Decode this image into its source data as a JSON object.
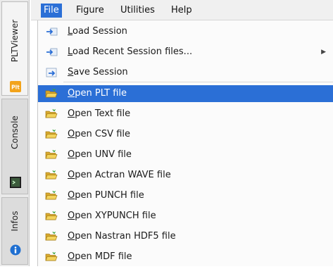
{
  "dock": {
    "tabs": [
      {
        "label": "PLTViewer",
        "icon": "plt-icon"
      },
      {
        "label": "Console",
        "icon": "console-icon"
      },
      {
        "label": "Infos",
        "icon": "info-icon"
      }
    ],
    "plt_icon_text": "Plt"
  },
  "menubar": {
    "items": [
      "File",
      "Figure",
      "Utilities",
      "Help"
    ]
  },
  "file_menu": {
    "items": [
      {
        "label": "Load Session",
        "icon": "load-session-icon"
      },
      {
        "label": "Load Recent Session files...",
        "icon": "load-session-icon",
        "submenu": true
      },
      {
        "label": "Save Session",
        "icon": "save-session-icon"
      },
      {
        "label": "Open PLT file",
        "icon": "folder-open-icon",
        "highlighted": true
      },
      {
        "label": "Open Text file",
        "icon": "folder-open-icon"
      },
      {
        "label": "Open CSV file",
        "icon": "folder-open-icon"
      },
      {
        "label": "Open UNV file",
        "icon": "folder-open-icon"
      },
      {
        "label": "Open Actran WAVE file",
        "icon": "folder-open-icon"
      },
      {
        "label": "Open PUNCH file",
        "icon": "folder-open-icon"
      },
      {
        "label": "Open XYPUNCH file",
        "icon": "folder-open-icon"
      },
      {
        "label": "Open Nastran HDF5 file",
        "icon": "folder-open-icon"
      },
      {
        "label": "Open MDF file",
        "icon": "folder-open-icon"
      }
    ]
  },
  "colors": {
    "highlight": "#2b6fd6",
    "folder": "#e8c84a",
    "plt_badge": "#f2a31b",
    "info": "#1f6fd1"
  }
}
